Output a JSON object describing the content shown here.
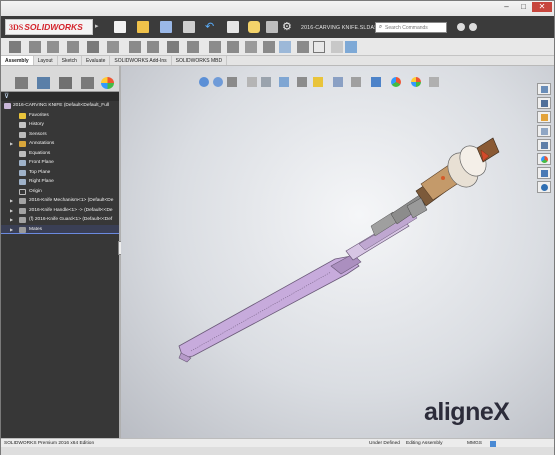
{
  "app": {
    "logo_brand": "3DS",
    "logo_name": "SOLIDWORKS",
    "document_title": "2016-CARVING KNIFE.SLDASM *",
    "search_placeholder": "Search Commands"
  },
  "window_controls": {
    "minimize": "–",
    "maximize": "□",
    "close": "✕"
  },
  "tabs": [
    {
      "label": "Assembly",
      "active": true
    },
    {
      "label": "Layout",
      "active": false
    },
    {
      "label": "Sketch",
      "active": false
    },
    {
      "label": "Evaluate",
      "active": false
    },
    {
      "label": "SOLIDWORKS Add-Ins",
      "active": false
    },
    {
      "label": "SOLIDWORKS MBD",
      "active": false
    }
  ],
  "feature_tree": {
    "root": "2016-CARVING KNIFE (Default<Default_Full",
    "nodes": [
      {
        "label": "Favorites",
        "icon": "star-icon"
      },
      {
        "label": "History",
        "icon": "history-icon"
      },
      {
        "label": "Sensors",
        "icon": "sensor-icon"
      },
      {
        "label": "Annotations",
        "icon": "annotation-icon"
      },
      {
        "label": "Equations",
        "icon": "equation-icon"
      },
      {
        "label": "Front Plane",
        "icon": "plane-icon"
      },
      {
        "label": "Top Plane",
        "icon": "plane-icon"
      },
      {
        "label": "Right Plane",
        "icon": "plane-icon"
      },
      {
        "label": "Origin",
        "icon": "origin-icon"
      },
      {
        "label": "2016-Knife Mechanism<1> (Default<De",
        "icon": "part-icon"
      },
      {
        "label": "2016-Knife Handle<1> -> (Default<<De",
        "icon": "part-icon"
      },
      {
        "label": "(f) 2016-Knife Guard<1> (Default<<Def",
        "icon": "part-icon"
      },
      {
        "label": "Mates",
        "icon": "mates-icon"
      }
    ]
  },
  "status_bar": {
    "product": "SOLIDWORKS Premium 2016 x64 Edition",
    "definition": "Under Defined",
    "mode": "Editing Assembly",
    "units": "MMGS"
  },
  "watermark": {
    "text": "aligne",
    "accent": "X"
  },
  "colors": {
    "titlebar": "#3b3b3b",
    "brand_red": "#d4242c",
    "tree_bg": "#373737",
    "knife_body": "#c8aede"
  }
}
